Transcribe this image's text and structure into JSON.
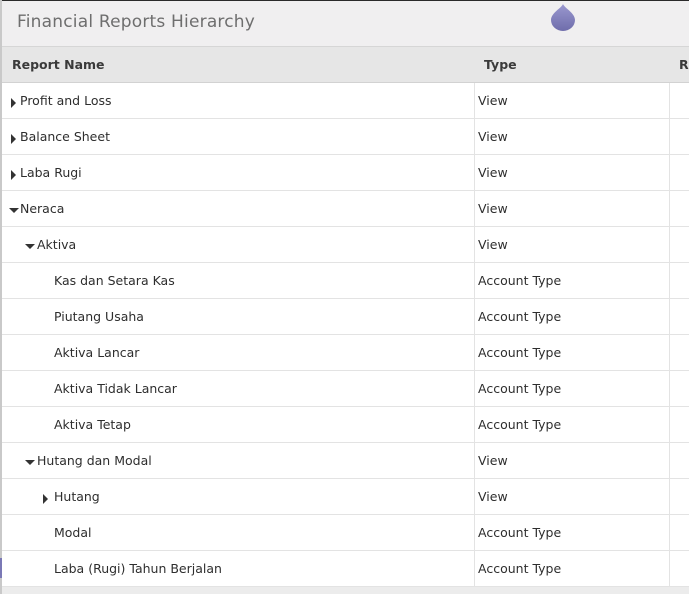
{
  "window": {
    "title": "Financial Reports Hierarchy"
  },
  "table": {
    "columns": [
      "Report Name",
      "Type",
      "Re"
    ],
    "rows": [
      {
        "name": "Profit and Loss",
        "type": "View",
        "level": 0,
        "toggle": "collapsed"
      },
      {
        "name": "Balance Sheet",
        "type": "View",
        "level": 0,
        "toggle": "collapsed"
      },
      {
        "name": "Laba Rugi",
        "type": "View",
        "level": 0,
        "toggle": "collapsed"
      },
      {
        "name": "Neraca",
        "type": "View",
        "level": 0,
        "toggle": "expanded"
      },
      {
        "name": "Aktiva",
        "type": "View",
        "level": 1,
        "toggle": "expanded"
      },
      {
        "name": "Kas dan Setara Kas",
        "type": "Account Type",
        "level": 2,
        "toggle": "none"
      },
      {
        "name": "Piutang Usaha",
        "type": "Account Type",
        "level": 2,
        "toggle": "none"
      },
      {
        "name": "Aktiva Lancar",
        "type": "Account Type",
        "level": 2,
        "toggle": "none"
      },
      {
        "name": "Aktiva Tidak Lancar",
        "type": "Account Type",
        "level": 2,
        "toggle": "none"
      },
      {
        "name": "Aktiva Tetap",
        "type": "Account Type",
        "level": 2,
        "toggle": "none"
      },
      {
        "name": "Hutang dan Modal",
        "type": "View",
        "level": 1,
        "toggle": "expanded"
      },
      {
        "name": "Hutang",
        "type": "View",
        "level": 2,
        "toggle": "collapsed"
      },
      {
        "name": "Modal",
        "type": "Account Type",
        "level": 2,
        "toggle": "none"
      },
      {
        "name": "Laba (Rugi) Tahun Berjalan",
        "type": "Account Type",
        "level": 2,
        "toggle": "none"
      }
    ]
  },
  "icons": {
    "collapsed": "caret-right-icon",
    "expanded": "caret-down-icon",
    "drop_handle": "drop-handle-icon"
  },
  "colors": {
    "title_bar": "#f0eff0",
    "header": "#e6e6e6",
    "accent": "#7a78b5",
    "text": "#2e2e2e"
  }
}
